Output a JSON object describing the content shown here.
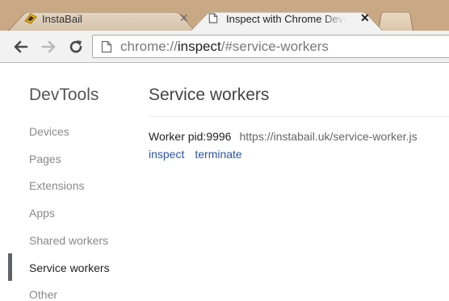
{
  "tabs": [
    {
      "title": "InstaBail",
      "close": "✕",
      "active": false
    },
    {
      "title": "Inspect with Chrome Developer Tools",
      "close": "✕",
      "active": true
    }
  ],
  "address": {
    "scheme": "chrome://",
    "host": "inspect",
    "path": "/#service-workers"
  },
  "sidebar": {
    "title": "DevTools",
    "items": [
      {
        "label": "Devices"
      },
      {
        "label": "Pages"
      },
      {
        "label": "Extensions"
      },
      {
        "label": "Apps"
      },
      {
        "label": "Shared workers"
      },
      {
        "label": "Service workers",
        "selected": true
      },
      {
        "label": "Other"
      }
    ]
  },
  "main": {
    "title": "Service workers",
    "worker": {
      "pid": "Worker pid:9996",
      "url": "https://instabail.uk/service-worker.js",
      "actions": {
        "inspect": "inspect",
        "terminate": "terminate"
      }
    }
  },
  "colors": {
    "tabstrip": "#c9a985",
    "link": "#2a55a8",
    "selected_bar": "#5f6368"
  }
}
